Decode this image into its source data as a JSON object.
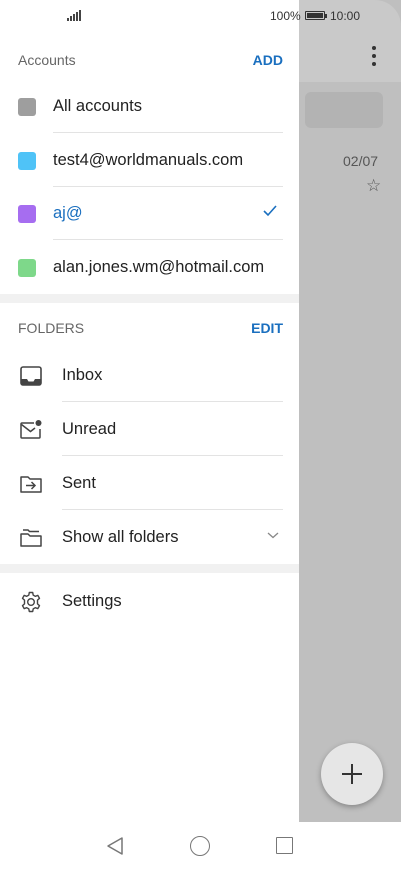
{
  "status_bar": {
    "battery": "100%",
    "time": "10:00"
  },
  "background_app": {
    "date": "02/07",
    "star": "☆"
  },
  "accounts": {
    "title": "Accounts",
    "action": "ADD",
    "items": [
      {
        "label": "All accounts",
        "color": "#9e9e9e"
      },
      {
        "label": "test4@worldmanuals.com",
        "color": "#4fc3f7"
      },
      {
        "label": "aj@",
        "color": "#a66df0",
        "active": true
      },
      {
        "label": "alan.jones.wm@hotmail.com",
        "color": "#7ed88a"
      }
    ]
  },
  "folders": {
    "title": "FOLDERS",
    "action": "EDIT",
    "items": [
      {
        "label": "Inbox",
        "icon": "inbox-icon"
      },
      {
        "label": "Unread",
        "icon": "unread-mail-icon"
      },
      {
        "label": "Sent",
        "icon": "sent-folder-icon"
      },
      {
        "label": "Show all folders",
        "icon": "folders-icon"
      }
    ]
  },
  "settings": {
    "label": "Settings",
    "icon": "gear-icon"
  },
  "colors": {
    "accent": "#1a6fbf"
  }
}
